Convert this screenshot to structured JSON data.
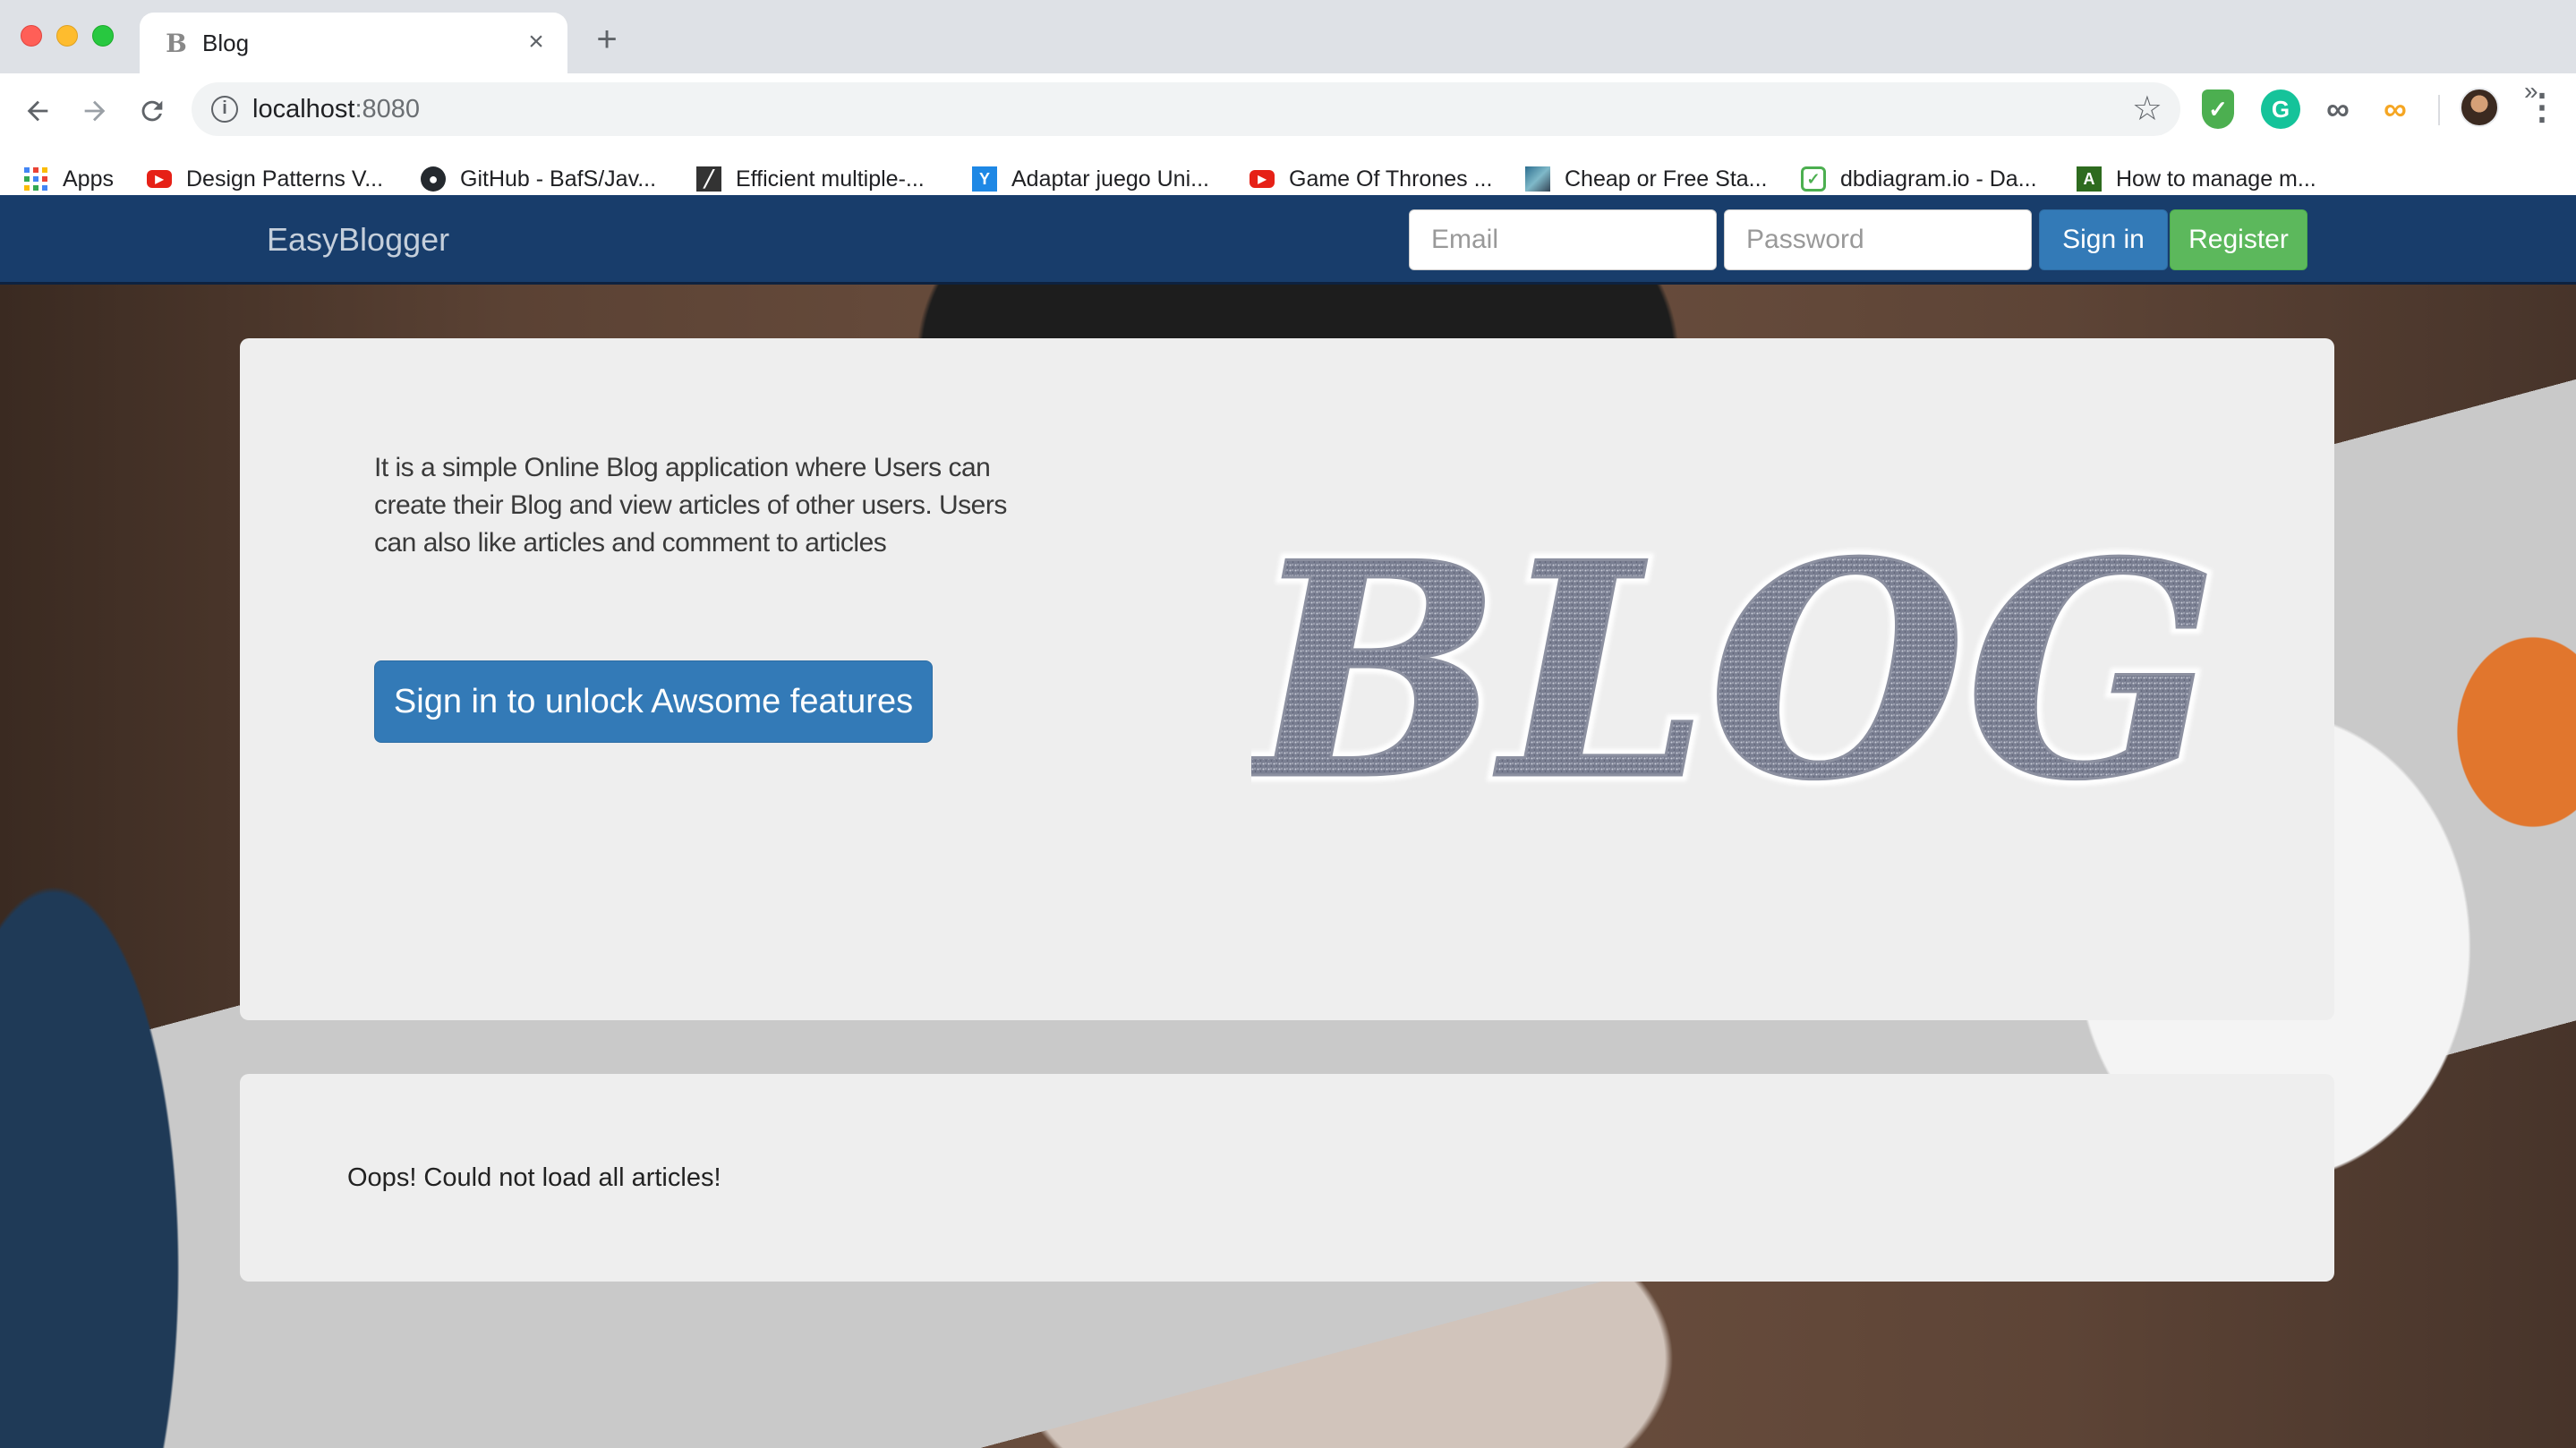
{
  "browser": {
    "tab": {
      "title": "Blog",
      "favicon": "B",
      "close": "×"
    },
    "new_tab": "+",
    "url": {
      "host": "localhost",
      "port": ":8080"
    },
    "menu": "⋮",
    "bookmarks": [
      {
        "label": "Apps",
        "icon": "apps-grid-icon"
      },
      {
        "label": "Design Patterns V...",
        "icon": "youtube-icon"
      },
      {
        "label": "GitHub - BafS/Jav...",
        "icon": "github-icon"
      },
      {
        "label": "Efficient multiple-...",
        "icon": "page-icon"
      },
      {
        "label": "Adaptar juego Uni...",
        "icon": "dark-icon"
      },
      {
        "label": "Game Of Thrones ...",
        "icon": "youtube-icon"
      },
      {
        "label": "Cheap or Free Sta...",
        "icon": "site-icon"
      },
      {
        "label": "dbdiagram.io - Da...",
        "icon": "hexagon-icon"
      },
      {
        "label": "How to manage m...",
        "icon": "green-square-icon"
      }
    ],
    "bookmarks_more": "»"
  },
  "navbar": {
    "brand": "EasyBlogger",
    "email_placeholder": "Email",
    "password_placeholder": "Password",
    "signin_label": "Sign in",
    "register_label": "Register"
  },
  "hero": {
    "text": "It is a simple Online Blog application where Users can create their Blog and view articles of other users. Users can also like articles and comment to articles",
    "button_label": "Sign in to unlock Awsome features",
    "art_text": "BLOG"
  },
  "articles": {
    "message": "Oops! Could not load all articles!"
  },
  "colors": {
    "navbar_bg": "#183d6b",
    "primary_button": "#337ab7",
    "success_button": "#5cb85c",
    "panel_bg": "#eeeeee"
  }
}
